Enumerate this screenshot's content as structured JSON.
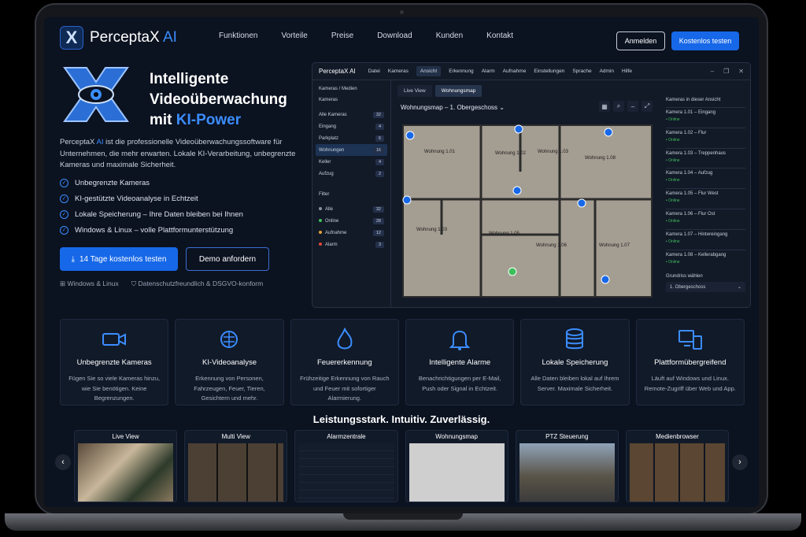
{
  "brand": {
    "name": "PerceptaX",
    "suffix": "AI"
  },
  "nav": {
    "items": [
      "Funktionen",
      "Vorteile",
      "Preise",
      "Download",
      "Kunden",
      "Kontakt"
    ],
    "login": "Anmelden",
    "signup": "Kostenlos testen"
  },
  "hero": {
    "title_l1": "Intelligente",
    "title_l2": "Videoüberwachung",
    "title_l3a": "mit ",
    "title_l3b": "KI-Power",
    "desc_brand": "PerceptaX",
    "desc_ai": "AI",
    "desc": " ist die professionelle Videoüberwachungssoftware für Unternehmen, die mehr erwarten. Lokale KI-Verarbeitung, unbegrenzte Kameras und maximale Sicherheit.",
    "features": [
      "Unbegrenzte Kameras",
      "KI-gestützte Videoanalyse in Echtzeit",
      "Lokale Speicherung – Ihre Daten bleiben bei Ihnen",
      "Windows & Linux – volle Plattformunterstützung"
    ],
    "cta_primary": "14 Tage kostenlos testen",
    "cta_secondary": "Demo anfordern",
    "os": "Windows & Linux",
    "privacy": "Datenschutzfreundlich & DSGVO-konform"
  },
  "app": {
    "title": "PerceptaX AI",
    "menu": [
      "Datei",
      "Kameras",
      "Ansicht",
      "Erkennung",
      "Alarm",
      "Aufnahme",
      "Einstellungen",
      "Sprache",
      "Admin",
      "Hilfe"
    ],
    "left_header": "Kameras / Medien",
    "cams_label": "Kameras",
    "cams": [
      {
        "n": "Alle Kameras",
        "c": "32"
      },
      {
        "n": "Eingang",
        "c": "4"
      },
      {
        "n": "Parkplatz",
        "c": "6"
      },
      {
        "n": "Wohnungen",
        "c": "16"
      },
      {
        "n": "Keller",
        "c": "4"
      },
      {
        "n": "Aufzug",
        "c": "2"
      }
    ],
    "filter_label": "Filter",
    "filters": [
      {
        "n": "Alle",
        "c": "32"
      },
      {
        "n": "Online",
        "c": "28"
      },
      {
        "n": "Aufnahme",
        "c": "12"
      },
      {
        "n": "Alarm",
        "c": "3"
      }
    ],
    "tabs": [
      "Live View",
      "Wohnungsmap"
    ],
    "map_title": "Wohnungsmap – 1. Obergeschoss",
    "rooms": [
      "Wohnung 1.01",
      "Wohnung 1.02",
      "Wohnung 1.03",
      "Wohnung 1.03",
      "Wohnung 1.05",
      "Wohnung 1.06",
      "Wohnung 1.07",
      "Wohnung 1.08"
    ],
    "right_header": "Kameras in dieser Ansicht",
    "cameras": [
      "Kamera 1.01 – Eingang",
      "Kamera 1.02 – Flur",
      "Kamera 1.03 – Treppenhaus",
      "Kamera 1.04 – Aufzug",
      "Kamera 1.05 – Flur West",
      "Kamera 1.06 – Flur Ost",
      "Kamera 1.07 – Hintereingang",
      "Kamera 1.08 – Kellerabgang"
    ],
    "online": "• Online",
    "floor_label": "Grundriss wählen",
    "floor_value": "1. Obergeschoss"
  },
  "cards": [
    {
      "t": "Unbegrenzte Kameras",
      "d": "Fügen Sie so viele Kameras hinzu, wie Sie benötigen. Keine Begrenzungen."
    },
    {
      "t": "KI-Videoanalyse",
      "d": "Erkennung von Personen, Fahrzeugen, Feuer, Tieren, Gesichtern und mehr."
    },
    {
      "t": "Feuererkennung",
      "d": "Frühzeitige Erkennung von Rauch und Feuer mit sofortiger Alarmierung."
    },
    {
      "t": "Intelligente Alarme",
      "d": "Benachrichtigungen per E-Mail, Push oder Signal in Echtzeit."
    },
    {
      "t": "Lokale Speicherung",
      "d": "Alle Daten bleiben lokal auf Ihrem Server. Maximale Sicherheit."
    },
    {
      "t": "Plattformübergreifend",
      "d": "Läuft auf Windows und Linux. Remote-Zugriff über Web und App."
    }
  ],
  "tagline": "Leistungsstark. Intuitiv. Zuverlässig.",
  "thumbs": [
    "Live View",
    "Multi View",
    "Alarmzentrale",
    "Wohnungsmap",
    "PTZ Steuerung",
    "Medienbrowser"
  ],
  "colors": {
    "accent": "#1768e8",
    "brand_blue": "#3b8dff",
    "online": "#3fbf5b",
    "alarm": "#e0463a",
    "bg": "#0b1220"
  }
}
